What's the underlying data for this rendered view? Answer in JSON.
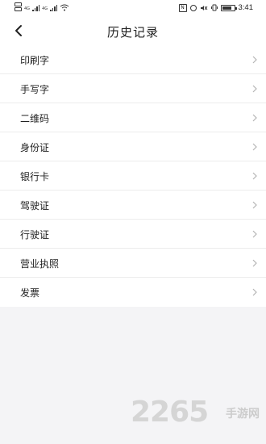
{
  "status_bar": {
    "sim1_label": "4G",
    "sim2_label": "4G",
    "battery_level": 0.7,
    "time": "3:41"
  },
  "header": {
    "title": "历史记录",
    "back_icon": "chevron-left-icon"
  },
  "list": {
    "items": [
      {
        "label": "印刷字"
      },
      {
        "label": "手写字"
      },
      {
        "label": "二维码"
      },
      {
        "label": "身份证"
      },
      {
        "label": "银行卡"
      },
      {
        "label": "驾驶证"
      },
      {
        "label": "行驶证"
      },
      {
        "label": "营业执照"
      },
      {
        "label": "发票"
      }
    ],
    "chevron_icon": "chevron-right-icon"
  },
  "watermark": {
    "digits": "2265",
    "text": "手游网"
  },
  "colors": {
    "background": "#f4f4f6",
    "surface": "#ffffff",
    "text": "#222222",
    "chevron": "#b5b5b5",
    "divider": "#ececec"
  }
}
